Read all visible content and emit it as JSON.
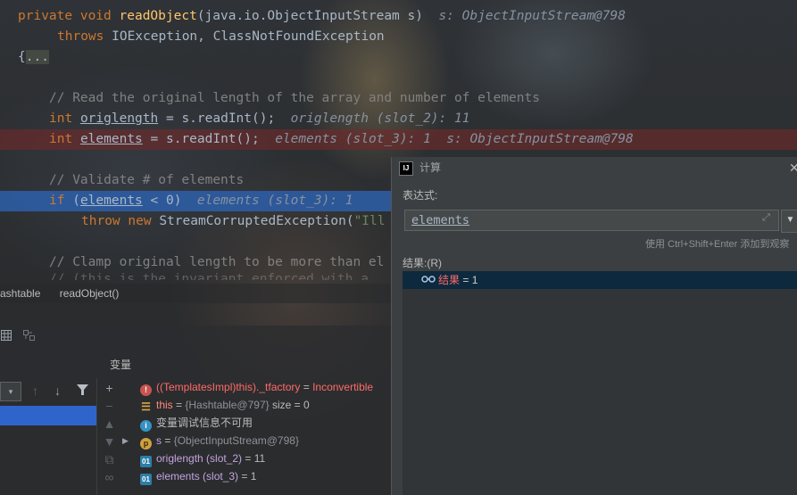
{
  "code": {
    "line1_kw1": "private",
    "line1_kw2": "void",
    "line1_fn": "readObject",
    "line1_rest": "(java.io.ObjectInputStream s)",
    "line1_hint": "s: ObjectInputStream@798",
    "line2_kw": "throws",
    "line2_rest": " IOException, ClassNotFoundException",
    "line3_brace": "{",
    "line3_fold": "...",
    "line4_comment": "// Read the original length of the array and number of elements",
    "line5_kw": "int",
    "line5_var": "origlength",
    "line5_rest": " = s.readInt();",
    "line5_hint": "origlength (slot_2): 11",
    "line6_kw": "int",
    "line6_var": "elements",
    "line6_rest": " = s.readInt();",
    "line6_hint": "elements (slot_3): 1  s: ObjectInputStream@798",
    "line7_comment": "// Validate # of elements",
    "line8_kw": "if",
    "line8_open": " (",
    "line8_var": "elements",
    "line8_rest": " < 0)",
    "line8_hint": "elements (slot_3): 1",
    "line9_kw1": "throw",
    "line9_kw2": "new",
    "line9_rest": " StreamCorruptedException(",
    "line9_str": "\"Ill",
    "line10_comment": "// Clamp original length to be more than el",
    "line11_comment": "// (this is the invariant enforced with a"
  },
  "breadcrumb": {
    "class_label": "ashtable",
    "method_label": "readObject()"
  },
  "debugger": {
    "variables_label": "变量",
    "frame_select_arrow": "▾",
    "toolbar_icons": [
      "table-icon",
      "layout-icon"
    ],
    "frame_icons": [
      "up-arrow-icon",
      "down-arrow-icon",
      "filter-icon"
    ],
    "var_toolbar_icons": [
      "plus-icon",
      "minus-icon",
      "up-icon",
      "down-icon",
      "copy-icon",
      "glasses-icon"
    ],
    "variables": [
      {
        "icon": "error-icon",
        "name": "((TemplatesImpl)this)._tfactory",
        "eq": " = ",
        "value": "Inconvertible"
      },
      {
        "icon": "list-icon",
        "name": "this",
        "eq": " = ",
        "value": "{Hashtable@797}",
        "extra": "  size = 0"
      },
      {
        "icon": "info-icon",
        "name": "变量调试信息不可用",
        "eq": "",
        "value": ""
      },
      {
        "icon": "param-icon",
        "name": "s",
        "eq": " = ",
        "value": "{ObjectInputStream@798}"
      },
      {
        "icon": "primitive-icon",
        "name": "origlength (slot_2)",
        "eq": " = ",
        "value": "11"
      },
      {
        "icon": "primitive-icon",
        "name": "elements (slot_3)",
        "eq": " = ",
        "value": "1"
      }
    ]
  },
  "evaluate_dialog": {
    "title": "计算",
    "logo": "IJ",
    "close": "✕",
    "expression_label": "表达式:",
    "expression_value": "elements",
    "expand_icon": "⤢",
    "dropdown": "▼",
    "hint": "使用 Ctrl+Shift+Enter 添加到观察",
    "result_label": "结果:(R)",
    "result_name": "结果",
    "result_eq": " = ",
    "result_value": "1"
  }
}
